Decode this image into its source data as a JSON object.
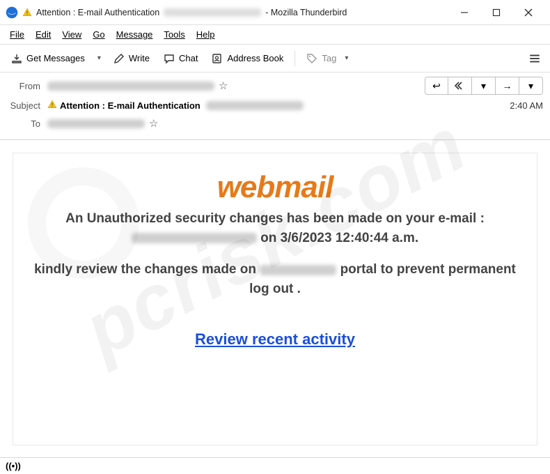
{
  "window": {
    "title_prefix": "Attention : E-mail Authentication",
    "title_suffix": " - Mozilla Thunderbird"
  },
  "menu": {
    "file": "File",
    "edit": "Edit",
    "view": "View",
    "go": "Go",
    "message": "Message",
    "tools": "Tools",
    "help": "Help"
  },
  "toolbar": {
    "get_messages": "Get Messages",
    "write": "Write",
    "chat": "Chat",
    "address_book": "Address Book",
    "tag": "Tag"
  },
  "header": {
    "from_label": "From",
    "subject_label": "Subject",
    "to_label": "To",
    "subject_text": "Attention : E-mail Authentication",
    "time": "2:40 AM"
  },
  "body": {
    "logo": "webmail",
    "line1_a": "An Unauthorized security changes has been made on your e-mail :",
    "line1_b": "on 3/6/2023 12:40:44 a.m.",
    "line2_a": "kindly review the changes made on",
    "line2_b": "portal to prevent permanent log out .",
    "cta": "Review recent activity"
  },
  "status": {
    "signal": "((•))"
  },
  "watermark": "pcrisk.com"
}
